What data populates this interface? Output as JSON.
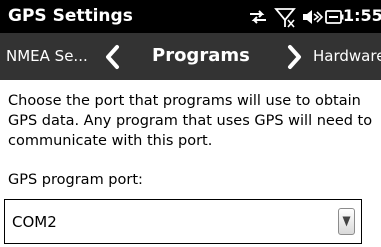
{
  "status_bar": {
    "title": "GPS Settings",
    "time": "1:55",
    "icons": [
      "data-sync-icon",
      "no-signal-icon",
      "volume-muted-icon",
      "battery-charging-icon"
    ]
  },
  "tabs": {
    "previous": "NMEA Se...",
    "current": "Programs",
    "next": "Hardware"
  },
  "content": {
    "description": "Choose the port that programs will use to obtain GPS data. Any program that uses GPS will need to communicate with this port.",
    "port_label": "GPS program port:",
    "port_value": "COM2"
  },
  "colors": {
    "status_bar_bg": "#000000",
    "tab_bar_bg": "#333333",
    "text": "#000000"
  }
}
